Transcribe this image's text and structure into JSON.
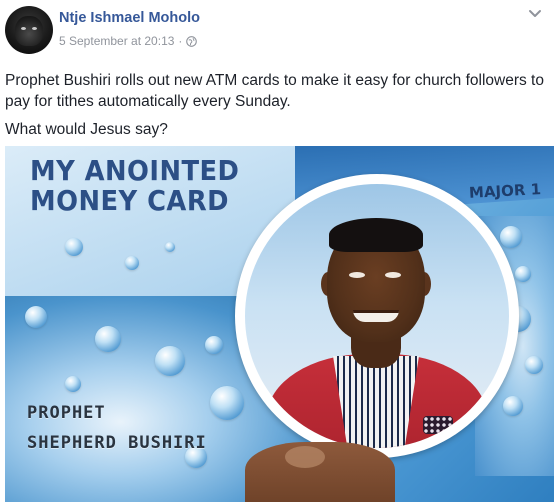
{
  "post": {
    "author_name": "Ntje Ishmael Moholo",
    "timestamp": "5 September at 20:13",
    "separator": "·",
    "privacy_icon": "globe-icon",
    "menu_icon": "chevron-down-icon",
    "text_paragraphs": [
      "Prophet Bushiri rolls out new ATM cards to make it easy for church followers to pay for tithes automatically every Sunday.",
      "What would Jesus say?"
    ]
  },
  "photo": {
    "card_title_line1": "MY ANOINTED",
    "card_title_line2": "MONEY CARD",
    "card_corner_text": "MAJOR 1",
    "card_name_line1": "PROPHET",
    "card_name_line2": "SHEPHERD BUSHIRI"
  },
  "colors": {
    "author_link": "#365899",
    "meta_text": "#90949c",
    "body_text": "#1d2129"
  }
}
